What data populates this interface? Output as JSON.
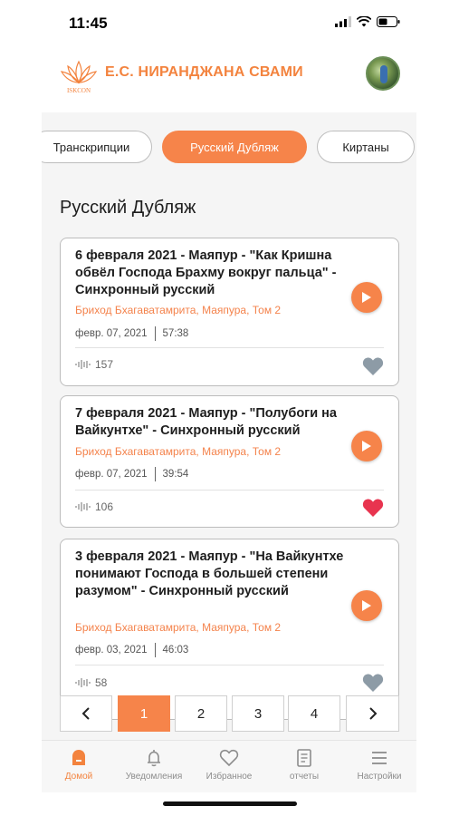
{
  "status_bar": {
    "time": "11:45"
  },
  "header": {
    "title": "Е.С. НИРАНДЖАНА СВАМИ",
    "logo_text": "ISKCON"
  },
  "tabs": [
    {
      "label": "Транскрипции",
      "active": false
    },
    {
      "label": "Русский Дубляж",
      "active": true
    },
    {
      "label": "Киртаны",
      "active": false
    }
  ],
  "section_title": "Русский Дубляж",
  "cards": [
    {
      "title": "6 февраля 2021 - Маяпур - \"Как Кришна обвёл Господа Брахму вокруг пальца\" - Синхронный русский",
      "subtitle": "Бриход Бхагаватамрита, Маяпура, Том 2",
      "date": "февр. 07, 2021",
      "duration": "57:38",
      "plays": "157",
      "favorite": false
    },
    {
      "title": "7 февраля 2021 - Маяпур - \"Полубоги на Вайкунтхе\" - Синхронный русский",
      "subtitle": "Бриход Бхагаватамрита, Маяпура, Том 2",
      "date": "февр. 07, 2021",
      "duration": "39:54",
      "plays": "106",
      "favorite": true
    },
    {
      "title": "3 февраля 2021 - Маяпур - \"На Вайкунтхе понимают Господа в большей степени разумом\" - Синхронный русский",
      "subtitle": "Бриход Бхагаватамрита, Маяпура, Том 2",
      "date": "февр. 03, 2021",
      "duration": "46:03",
      "plays": "58",
      "favorite": false
    }
  ],
  "pagination": {
    "prev": "‹",
    "next": "›",
    "pages": [
      "1",
      "2",
      "3",
      "4"
    ],
    "current": "1"
  },
  "bottom_nav": [
    {
      "label": "Домой",
      "icon": "home-icon",
      "active": true
    },
    {
      "label": "Уведомления",
      "icon": "bell-icon",
      "active": false
    },
    {
      "label": "Избранное",
      "icon": "heart-icon",
      "active": false
    },
    {
      "label": "отчеты",
      "icon": "report-icon",
      "active": false
    },
    {
      "label": "Настройки",
      "icon": "menu-icon",
      "active": false
    }
  ],
  "colors": {
    "accent": "#f6844a",
    "heart_active": "#e8344f",
    "heart_inactive": "#8d9ba6",
    "background": "#f5f5f5"
  }
}
